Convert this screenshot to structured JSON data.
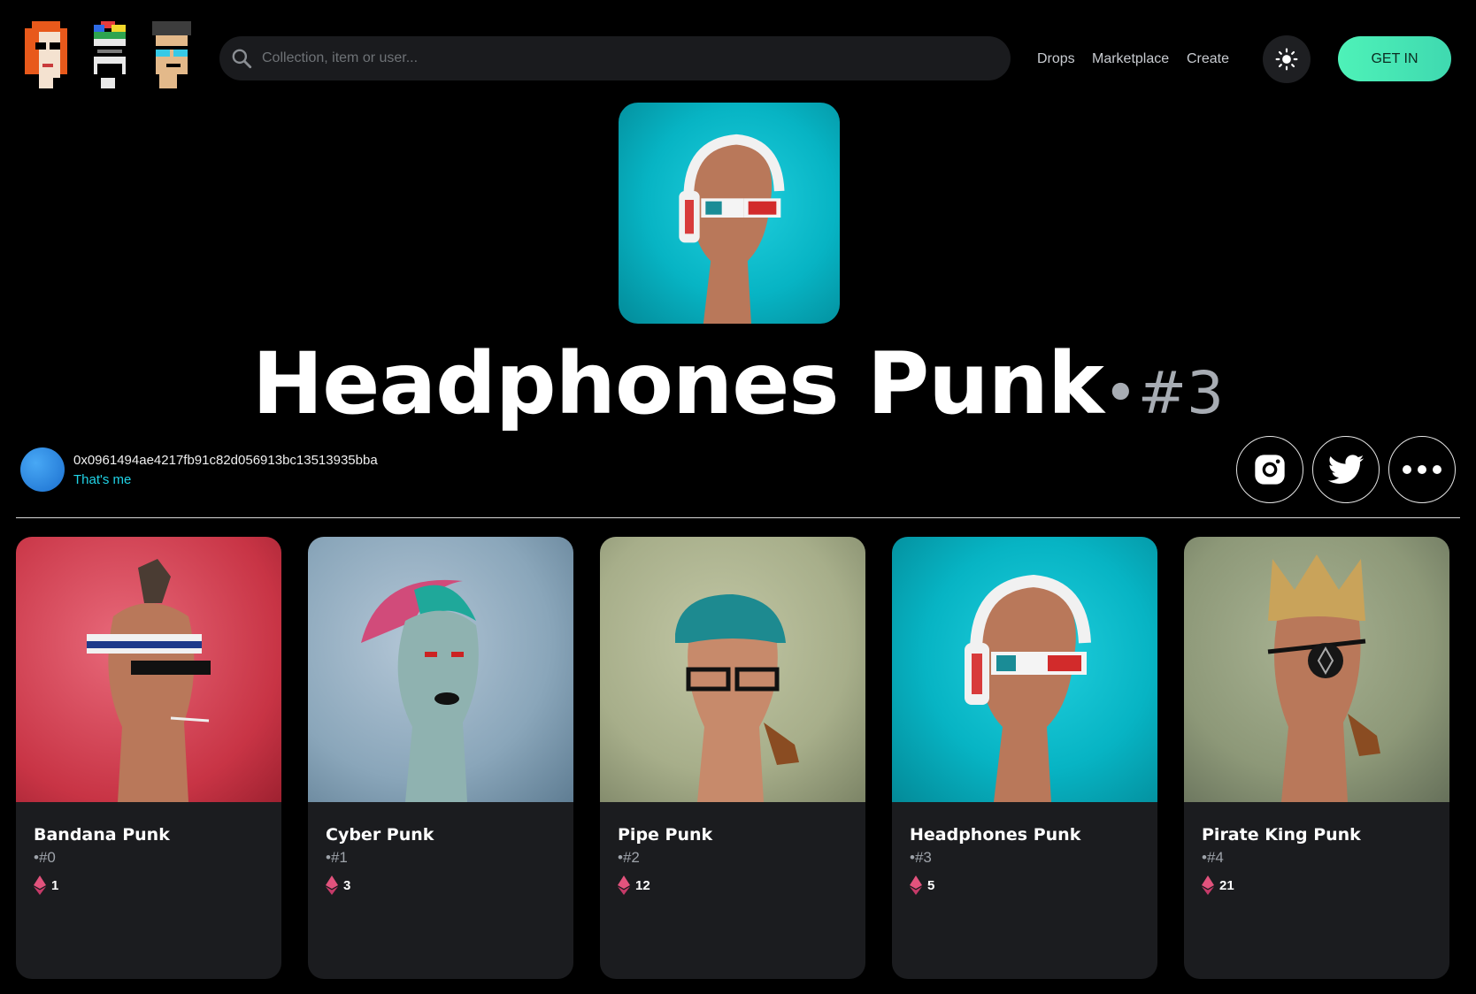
{
  "header": {
    "search_placeholder": "Collection, item or user...",
    "nav": {
      "drops": "Drops",
      "marketplace": "Marketplace",
      "create": "Create"
    },
    "cta": "GET IN"
  },
  "item": {
    "title": "Headphones Punk",
    "number": "•#3",
    "owner_address": "0x0961494ae4217fb91c82d056913bc13513935bba",
    "owner_note": "That's me"
  },
  "cards": [
    {
      "name": "Bandana Punk",
      "number": "•#0",
      "price": "1",
      "bg": "#d9475a"
    },
    {
      "name": "Cyber Punk",
      "number": "•#1",
      "price": "3",
      "bg": "#8aa6ba"
    },
    {
      "name": "Pipe Punk",
      "number": "•#2",
      "price": "12",
      "bg": "#a7ae8a"
    },
    {
      "name": "Headphones Punk",
      "number": "•#3",
      "price": "5",
      "bg": "#0fc0cf"
    },
    {
      "name": "Pirate King Punk",
      "number": "•#4",
      "price": "21",
      "bg": "#8d9878"
    }
  ],
  "icons": {
    "search": "search-icon",
    "theme": "sun-icon",
    "instagram": "instagram-icon",
    "twitter": "twitter-icon",
    "more": "more-icon",
    "currency": "ethereum-icon"
  },
  "colors": {
    "accent": "#3fe6b5",
    "link": "#20d3e6",
    "card": "#1b1c1f"
  }
}
